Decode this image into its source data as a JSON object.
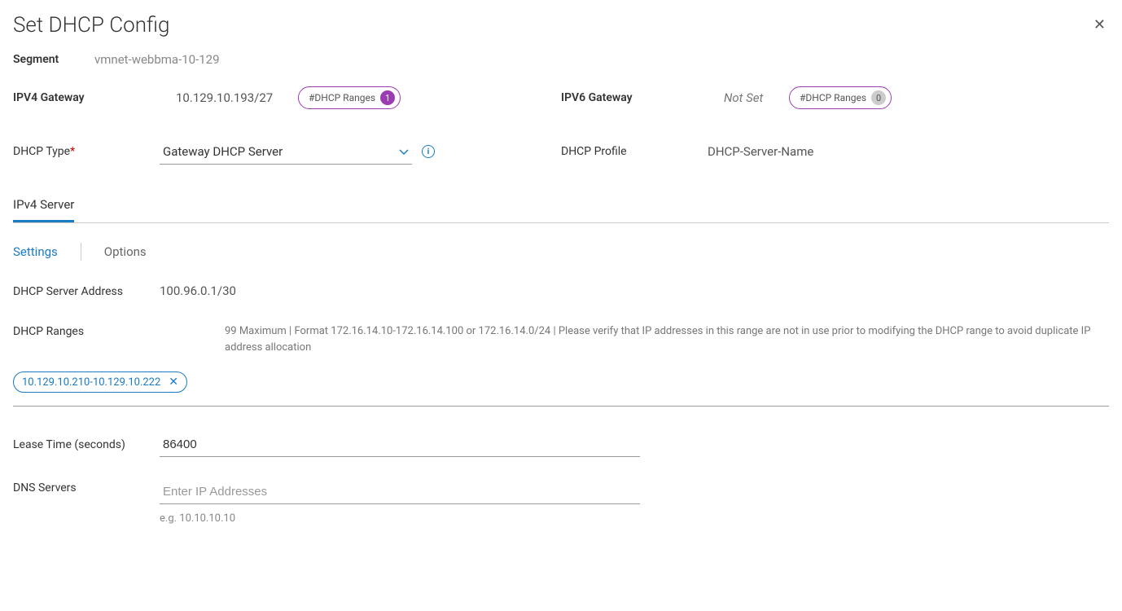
{
  "title": "Set DHCP Config",
  "segment": {
    "label": "Segment",
    "value": "vmnet-webbma-10-129"
  },
  "ipv4Gateway": {
    "label": "IPV4 Gateway",
    "value": "10.129.10.193/27",
    "rangesLabel": "#DHCP Ranges",
    "rangesCount": "1"
  },
  "ipv6Gateway": {
    "label": "IPV6 Gateway",
    "value": "Not Set",
    "rangesLabel": "#DHCP Ranges",
    "rangesCount": "0"
  },
  "dhcpType": {
    "label": "DHCP Type",
    "value": "Gateway DHCP Server"
  },
  "dhcpProfile": {
    "label": "DHCP Profile",
    "value": "DHCP-Server-Name"
  },
  "mainTabs": {
    "ipv4": "IPv4 Server"
  },
  "subTabs": {
    "settings": "Settings",
    "options": "Options"
  },
  "serverAddress": {
    "label": "DHCP Server Address",
    "value": "100.96.0.1/30"
  },
  "dhcpRanges": {
    "label": "DHCP Ranges",
    "hint": "99 Maximum | Format 172.16.14.10-172.16.14.100 or 172.16.14.0/24 | Please verify that IP addresses in this range are not in use prior to modifying the DHCP range to avoid duplicate IP address allocation",
    "tags": [
      "10.129.10.210-10.129.10.222"
    ]
  },
  "leaseTime": {
    "label": "Lease Time (seconds)",
    "value": "86400"
  },
  "dnsServers": {
    "label": "DNS Servers",
    "placeholder": "Enter IP Addresses",
    "hint": "e.g. 10.10.10.10"
  }
}
